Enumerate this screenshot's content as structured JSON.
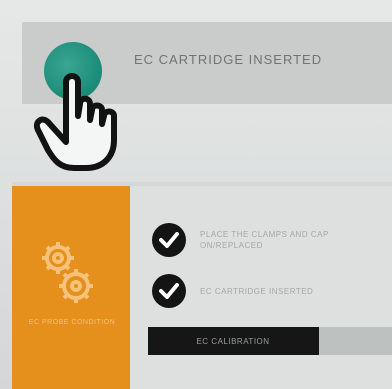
{
  "banner": {
    "status_text": "EC CARTRIDGE INSERTED",
    "status_color": "#1f8f7c"
  },
  "side_card": {
    "icon": "gear-icon",
    "label": "EC PROBE CONDITION",
    "accent": "#e58f1c"
  },
  "checklist": [
    {
      "icon": "check-icon",
      "label": "PLACE THE CLAMPS AND CAP ON/REPLACED"
    },
    {
      "icon": "check-icon",
      "label": "EC CARTRIDGE INSERTED"
    }
  ],
  "progress": {
    "label": "EC CALIBRATION",
    "fraction": 0.7
  }
}
